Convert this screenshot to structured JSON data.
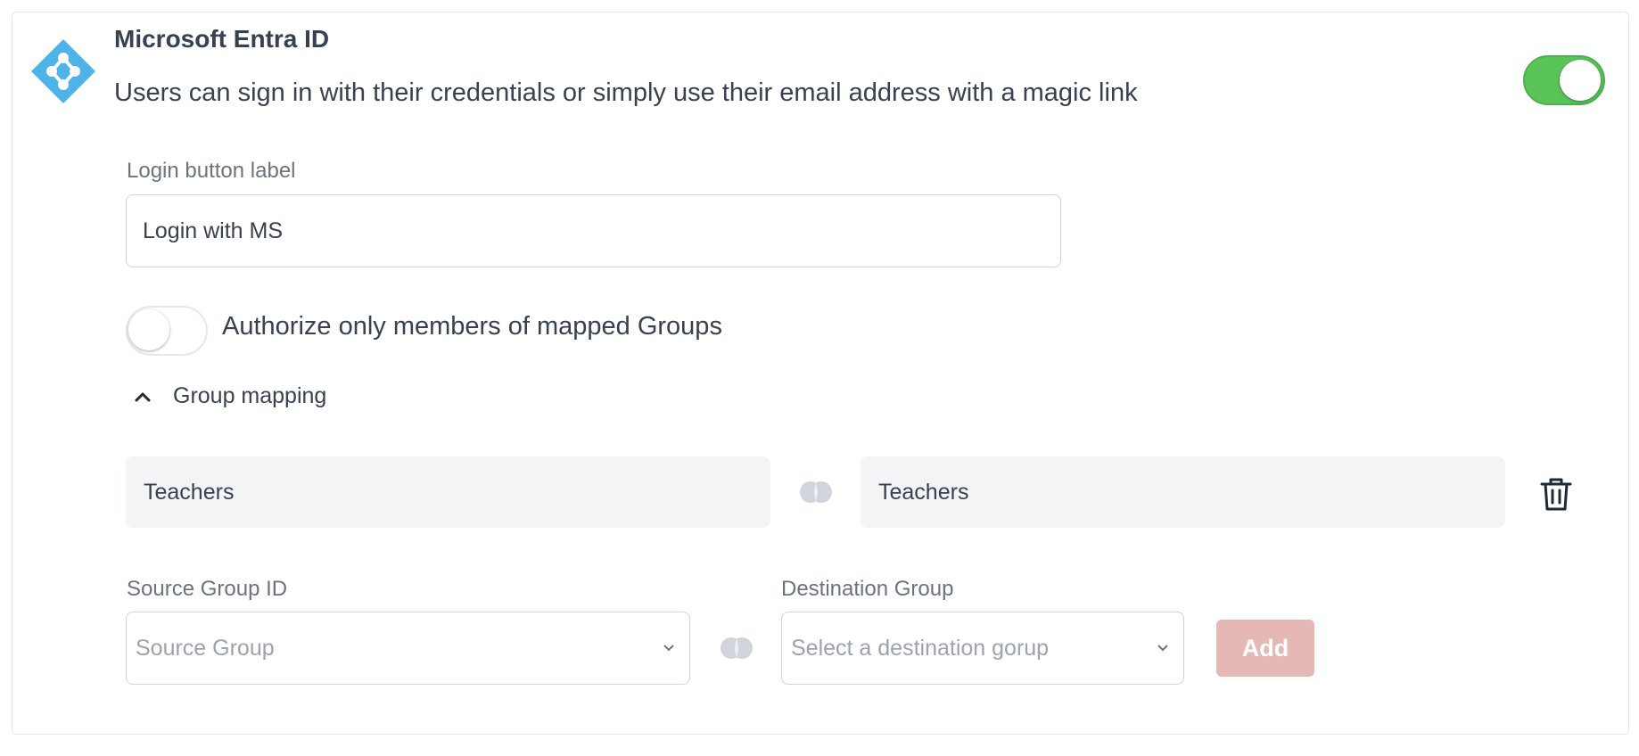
{
  "provider": {
    "title": "Microsoft Entra ID",
    "description": "Users can sign in with their credentials or simply use their email address with a magic link",
    "enabled": true,
    "logo_icon": "entra-id-diamond-icon",
    "accent_color": "#5ac35a"
  },
  "login_button": {
    "label": "Login button label",
    "value": "Login with MS"
  },
  "authorize": {
    "label": "Authorize only members of mapped Groups",
    "enabled": false
  },
  "group_mapping": {
    "label": "Group mapping",
    "expanded": true,
    "mappings": [
      {
        "source": "Teachers",
        "destination": "Teachers"
      }
    ]
  },
  "new_mapping": {
    "source_label": "Source Group ID",
    "source_placeholder": "Source Group",
    "destination_label": "Destination Group",
    "destination_placeholder": "Select a destination gorup",
    "add_label": "Add"
  },
  "colors": {
    "logo_blue": "#4fb3ea",
    "toggle_on": "#5ac35a",
    "add_disabled": "#e6b8b5"
  }
}
